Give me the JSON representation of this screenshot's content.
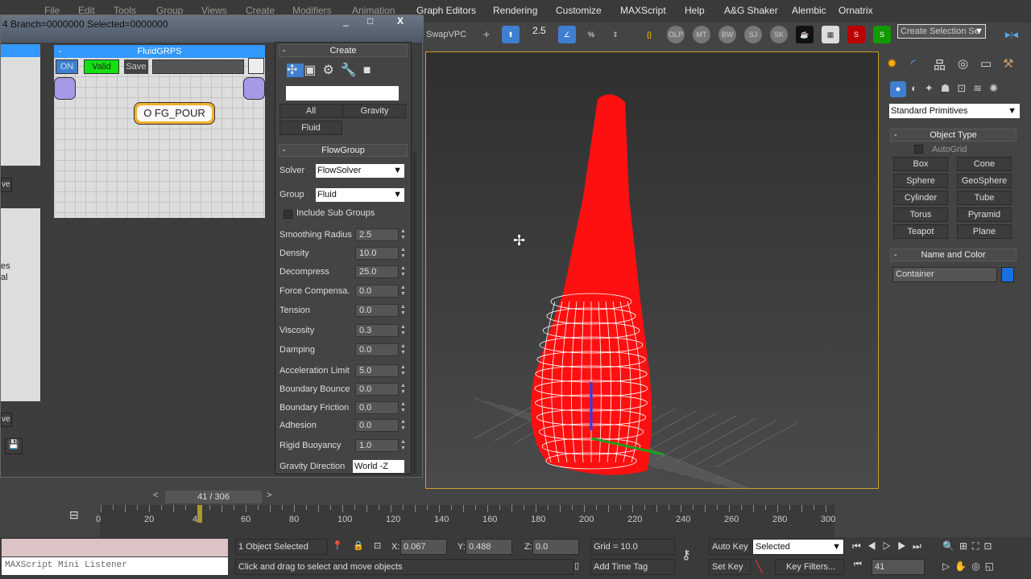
{
  "menu": [
    "File",
    "Edit",
    "Tools",
    "Group",
    "Views",
    "Create",
    "Modifiers",
    "Animation",
    "Graph Editors",
    "Rendering",
    "Customize",
    "MAXScript",
    "Help",
    "A&G Shaker",
    "Alembic",
    "Ornatrix"
  ],
  "toolbar": {
    "swap_label": "SwapVPC",
    "snap_angle": "2.5",
    "selection_set_placeholder": "Create Selection Se",
    "icons": [
      "move-gizmo-icon",
      "select-icon",
      "angle-snap-icon",
      "snap-icon",
      "percent-snap-icon",
      "spinner-snap-icon",
      "edit-named-sel-icon",
      "OLP",
      "MT",
      "BW",
      "SJ",
      "SK",
      "coffee-icon",
      "schematic-icon",
      "link-red-icon",
      "link-green-icon"
    ]
  },
  "window": {
    "title": "4  Branch=0000000  Selected=0000000",
    "minimize": "_",
    "maximize": "□",
    "close": "X"
  },
  "node_editor": {
    "title": "FluidGRPS",
    "on_label": "ON",
    "valid_label": "Valid",
    "save_label": "Save",
    "node_label": "O FG_POUR"
  },
  "left_strip": {
    "btn1": "ve",
    "text1": "es",
    "text2": "al",
    "btn2": "ve"
  },
  "create_panel": {
    "title": "Create",
    "buttons": [
      "All",
      "Gravity",
      "Fluid"
    ]
  },
  "flowgroup": {
    "title": "FlowGroup",
    "solver_label": "Solver",
    "solver_value": "FlowSolver",
    "group_label": "Group",
    "group_value": "Fluid",
    "include_sub_groups": "Include Sub Groups",
    "params": [
      {
        "label": "Smoothing  Radius",
        "value": "2.5"
      },
      {
        "label": "Density",
        "value": "10.0"
      },
      {
        "label": "Decompress",
        "value": "25.0"
      },
      {
        "label": "Force Compensa.",
        "value": "0.0"
      },
      {
        "label": "Tension",
        "value": "0.0"
      },
      {
        "label": "Viscosity",
        "value": "0.3"
      },
      {
        "label": "Damping",
        "value": "0.0"
      },
      {
        "label": "Acceleration Limit",
        "value": "5.0"
      },
      {
        "label": "Boundary Bounce",
        "value": "0.0"
      },
      {
        "label": "Boundary Friction",
        "value": "0.0"
      },
      {
        "label": "Adhesion",
        "value": "0.0"
      },
      {
        "label": "Rigid Buoyancy",
        "value": "1.0"
      }
    ],
    "gravity_label": "Gravity Direction",
    "gravity_value": "World -Z"
  },
  "command_panel": {
    "category": "Standard Primitives",
    "object_type": "Object Type",
    "autogrid": "AutoGrid",
    "primitives": [
      "Box",
      "Cone",
      "Sphere",
      "GeoSphere",
      "Cylinder",
      "Tube",
      "Torus",
      "Pyramid",
      "Teapot",
      "Plane"
    ],
    "name_color": "Name and Color",
    "name_value": "Container",
    "object_color": "#1a6fe0"
  },
  "timeline": {
    "frame": "41 / 306",
    "current_frame": 41,
    "total_frames": 306,
    "ticks": [
      "0",
      "20",
      "40",
      "60",
      "80",
      "100",
      "120",
      "140",
      "160",
      "180",
      "200",
      "220",
      "240",
      "260",
      "280",
      "300"
    ]
  },
  "status": {
    "listener": "MAXScript Mini Listener",
    "selected": "1 Object Selected",
    "prompt": "Click and drag to select and move objects",
    "x_label": "X:",
    "x": "0.067",
    "y_label": "Y:",
    "y": "0.488",
    "z_label": "Z:",
    "z": "0.0",
    "grid": "Grid = 10.0",
    "add_time_tag": "Add Time Tag",
    "auto_key": "Auto Key",
    "set_key": "Set Key",
    "key_mode": "Selected",
    "key_filters": "Key Filters...",
    "frame_field": "41"
  }
}
